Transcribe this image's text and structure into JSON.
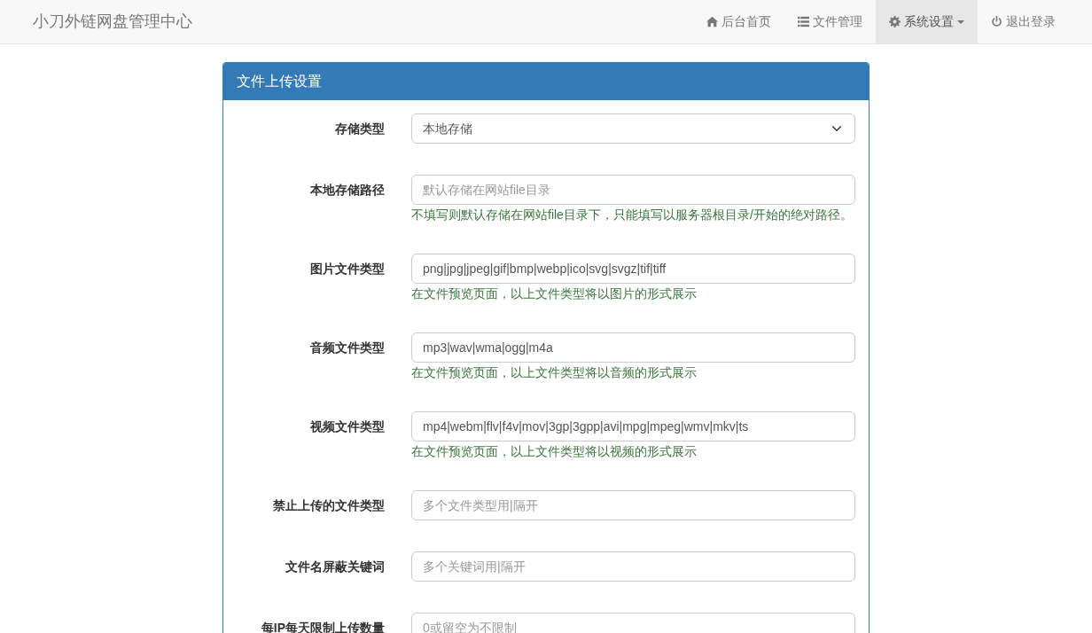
{
  "brand": "小刀外链网盘管理中心",
  "nav": [
    {
      "label": "后台首页",
      "selected": false,
      "dropdown": false
    },
    {
      "label": "文件管理",
      "selected": false,
      "dropdown": false
    },
    {
      "label": "系统设置",
      "selected": true,
      "dropdown": true
    },
    {
      "label": "退出登录",
      "selected": false,
      "dropdown": false
    }
  ],
  "panel": {
    "title": "文件上传设置",
    "fields": [
      {
        "kind": "select",
        "label": "存储类型",
        "value": "本地存储"
      },
      {
        "kind": "input",
        "label": "本地存储路径",
        "placeholder": "默认存储在网站file目录",
        "help": "不填写则默认存储在网站file目录下，只能填写以服务器根目录/开始的绝对路径。"
      },
      {
        "kind": "input",
        "label": "图片文件类型",
        "value": "png|jpg|jpeg|gif|bmp|webp|ico|svg|svgz|tif|tiff",
        "help": "在文件预览页面，以上文件类型将以图片的形式展示"
      },
      {
        "kind": "input",
        "label": "音频文件类型",
        "value": "mp3|wav|wma|ogg|m4a",
        "help": "在文件预览页面，以上文件类型将以音频的形式展示"
      },
      {
        "kind": "input",
        "label": "视频文件类型",
        "value": "mp4|webm|flv|f4v|mov|3gp|3gpp|avi|mpg|mpeg|wmv|mkv|ts",
        "help": "在文件预览页面，以上文件类型将以视频的形式展示"
      },
      {
        "kind": "input",
        "label": "禁止上传的文件类型",
        "placeholder": "多个文件类型用|隔开"
      },
      {
        "kind": "input",
        "label": "文件名屏蔽关键词",
        "placeholder": "多个关键词用|隔开"
      },
      {
        "kind": "input",
        "label": "每IP每天限制上传数量",
        "placeholder": "0或留空为不限制"
      }
    ]
  }
}
